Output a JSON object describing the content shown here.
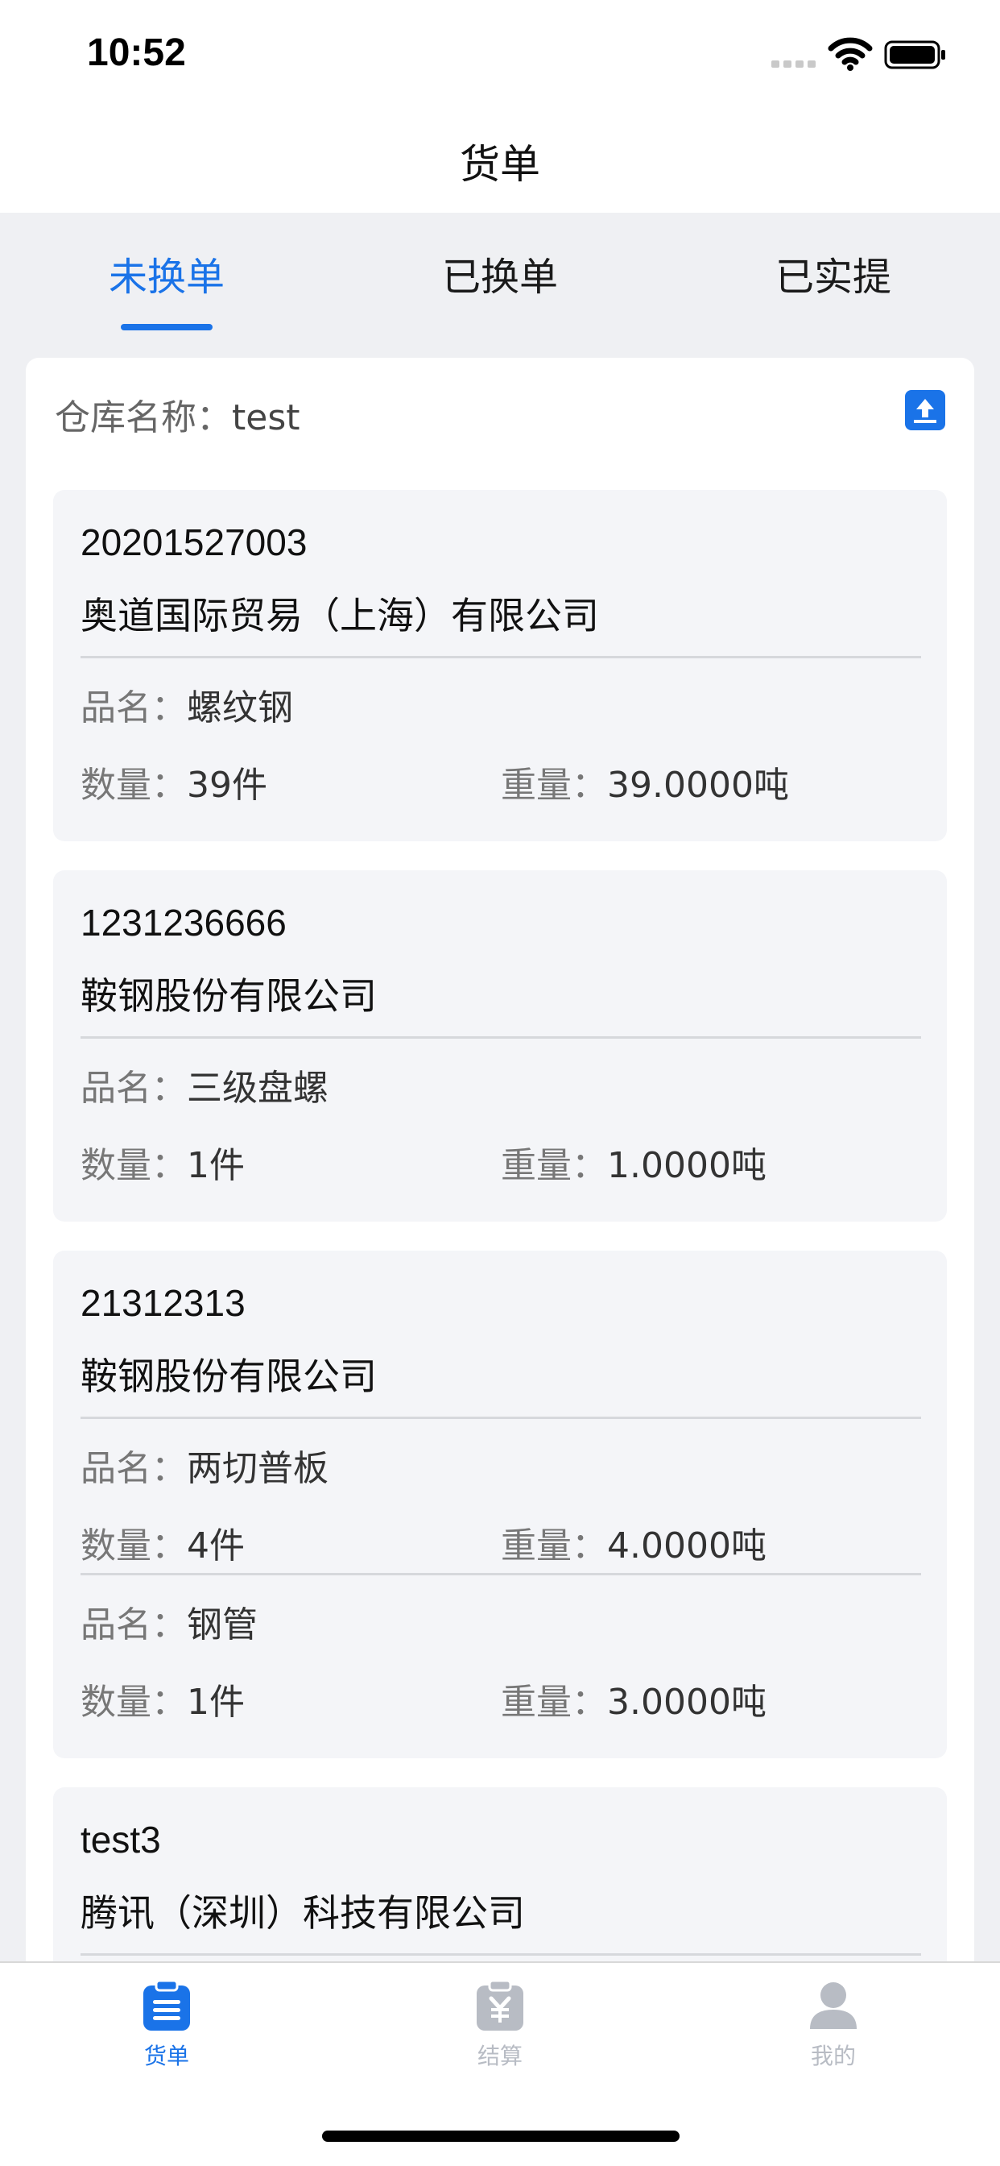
{
  "status_bar": {
    "time": "10:52"
  },
  "nav": {
    "title": "货单"
  },
  "tabs": [
    {
      "label": "未换单",
      "active": true
    },
    {
      "label": "已换单",
      "active": false
    },
    {
      "label": "已实提",
      "active": false
    }
  ],
  "warehouse": {
    "label": "仓库名称：",
    "value": "test",
    "action_icon": "upload-icon"
  },
  "labels": {
    "product": "品名：",
    "quantity": "数量：",
    "weight": "重量："
  },
  "orders": [
    {
      "number": "20201527003",
      "company": "奥道国际贸易（上海）有限公司",
      "items": [
        {
          "product": "螺纹钢",
          "quantity": "39件",
          "weight": "39.0000吨"
        }
      ]
    },
    {
      "number": "1231236666",
      "company": "鞍钢股份有限公司",
      "items": [
        {
          "product": "三级盘螺",
          "quantity": "1件",
          "weight": "1.0000吨"
        }
      ]
    },
    {
      "number": "21312313",
      "company": "鞍钢股份有限公司",
      "items": [
        {
          "product": "两切普板",
          "quantity": "4件",
          "weight": "4.0000吨"
        },
        {
          "product": "钢管",
          "quantity": "1件",
          "weight": "3.0000吨"
        }
      ]
    },
    {
      "number": "test3",
      "company": "腾讯（深圳）科技有限公司",
      "items": []
    }
  ],
  "tabbar": [
    {
      "label": "货单",
      "icon": "bill-icon",
      "active": true
    },
    {
      "label": "结算",
      "icon": "settlement-icon",
      "active": false
    },
    {
      "label": "我的",
      "icon": "profile-icon",
      "active": false
    }
  ],
  "colors": {
    "accent": "#1a73e8",
    "inactive": "#b8bcc4",
    "background": "#eff0f3"
  }
}
